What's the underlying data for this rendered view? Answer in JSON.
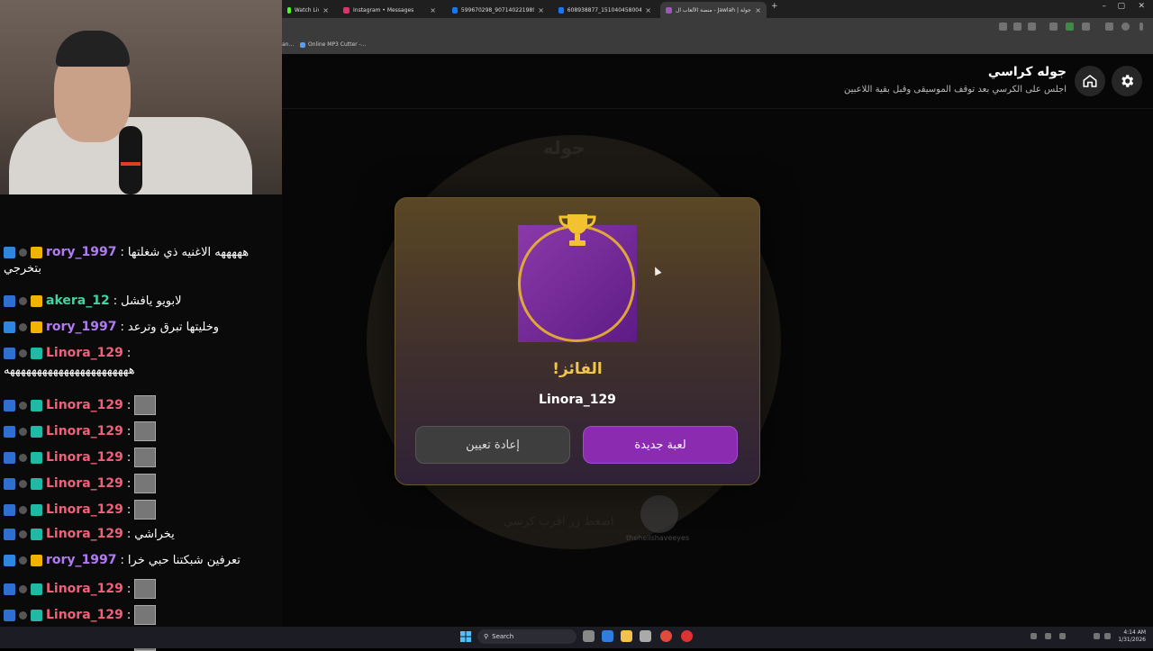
{
  "browser": {
    "tabs": [
      {
        "label": "Watch Live on Ki",
        "color": "#53fc18"
      },
      {
        "label": "Instagram • Messages",
        "color": "#e1306c"
      },
      {
        "label": "599670298_90714022198917…",
        "color": "#1877f2"
      },
      {
        "label": "608938877_151040458004683…",
        "color": "#1877f2"
      },
      {
        "label": "منصة الألعاب ال - Jawlah | جولة",
        "color": "#9b59b6"
      }
    ],
    "new_tab_symbol": "+",
    "bookmarks": [
      {
        "label": "an…"
      },
      {
        "label": "Online MP3 Cutter -…"
      }
    ],
    "window_controls": [
      "–",
      "▢",
      "✕"
    ]
  },
  "page": {
    "header": {
      "title": "جوله كراسي",
      "subtitle": "اجلس على الكرسي بعد توقف الموسيقى وقبل بقية اللاعبين",
      "home_icon": "home-icon",
      "settings_icon": "gear-icon"
    },
    "background": {
      "word": "جوله",
      "bottom_text": "اضغط زر اقرب كرسي",
      "ghost_name": "thehellshaveeyes"
    },
    "modal": {
      "trophy_icon": "trophy-icon",
      "winner_title": "الفائز!",
      "winner_name": "Linora_129",
      "reset_button": "إعادة تعيين",
      "new_game_button": "لعبة جديدة"
    }
  },
  "chat": {
    "messages": [
      {
        "user": "rory_1997",
        "color": "#b07cf0",
        "text": "هههههه الاغنيه ذي شغلتها",
        "cont": "بتخرجي"
      },
      {
        "user": "akera_12",
        "color": "#43d3a0",
        "text": "لابويو يافشل"
      },
      {
        "user": "rory_1997",
        "color": "#b07cf0",
        "text": "وخليتها تبرق وترعد"
      },
      {
        "user": "Linora_129",
        "color": "#f0607a",
        "text": "",
        "cont": "هههههههههههههههههههههههه"
      },
      {
        "user": "Linora_129",
        "color": "#f0607a",
        "text": "",
        "emote": true
      },
      {
        "user": "Linora_129",
        "color": "#f0607a",
        "text": "",
        "emote": true
      },
      {
        "user": "Linora_129",
        "color": "#f0607a",
        "text": "",
        "emote": true
      },
      {
        "user": "Linora_129",
        "color": "#f0607a",
        "text": "",
        "emote": true
      },
      {
        "user": "Linora_129",
        "color": "#f0607a",
        "text": "",
        "emote": true
      },
      {
        "user": "Linora_129",
        "color": "#f0607a",
        "text": "يخراشي"
      },
      {
        "user": "rory_1997",
        "color": "#b07cf0",
        "text": "تعرفين شبكتنا حبي خرا"
      },
      {
        "user": "Linora_129",
        "color": "#f0607a",
        "text": "",
        "emote": true
      },
      {
        "user": "Linora_129",
        "color": "#f0607a",
        "text": "",
        "emote": true
      },
      {
        "user": "Linora_129",
        "color": "#f0607a",
        "text": "",
        "emote": true
      }
    ],
    "colon": ":"
  },
  "taskbar": {
    "search_label": "Search",
    "time": "4:14 AM",
    "date": "1/31/2026"
  }
}
